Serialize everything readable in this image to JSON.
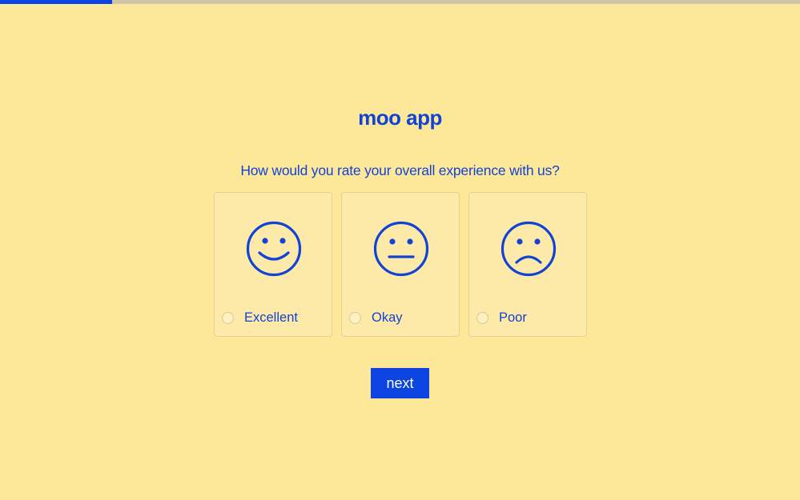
{
  "progress": {
    "value": 0.14,
    "fill_color": "#0b44e0",
    "track_color": "#cfc6a8"
  },
  "app": {
    "title": "moo app"
  },
  "survey": {
    "question": "How would you rate your overall experience with us?",
    "options": [
      {
        "label": "Excellent",
        "icon": "smiling-face-icon",
        "selected": false
      },
      {
        "label": "Okay",
        "icon": "neutral-face-icon",
        "selected": false
      },
      {
        "label": "Poor",
        "icon": "frowning-face-icon",
        "selected": false
      }
    ]
  },
  "actions": {
    "next_label": "next"
  },
  "colors": {
    "background": "#fde89a",
    "accent": "#1243d4",
    "button": "#0b44e0"
  }
}
